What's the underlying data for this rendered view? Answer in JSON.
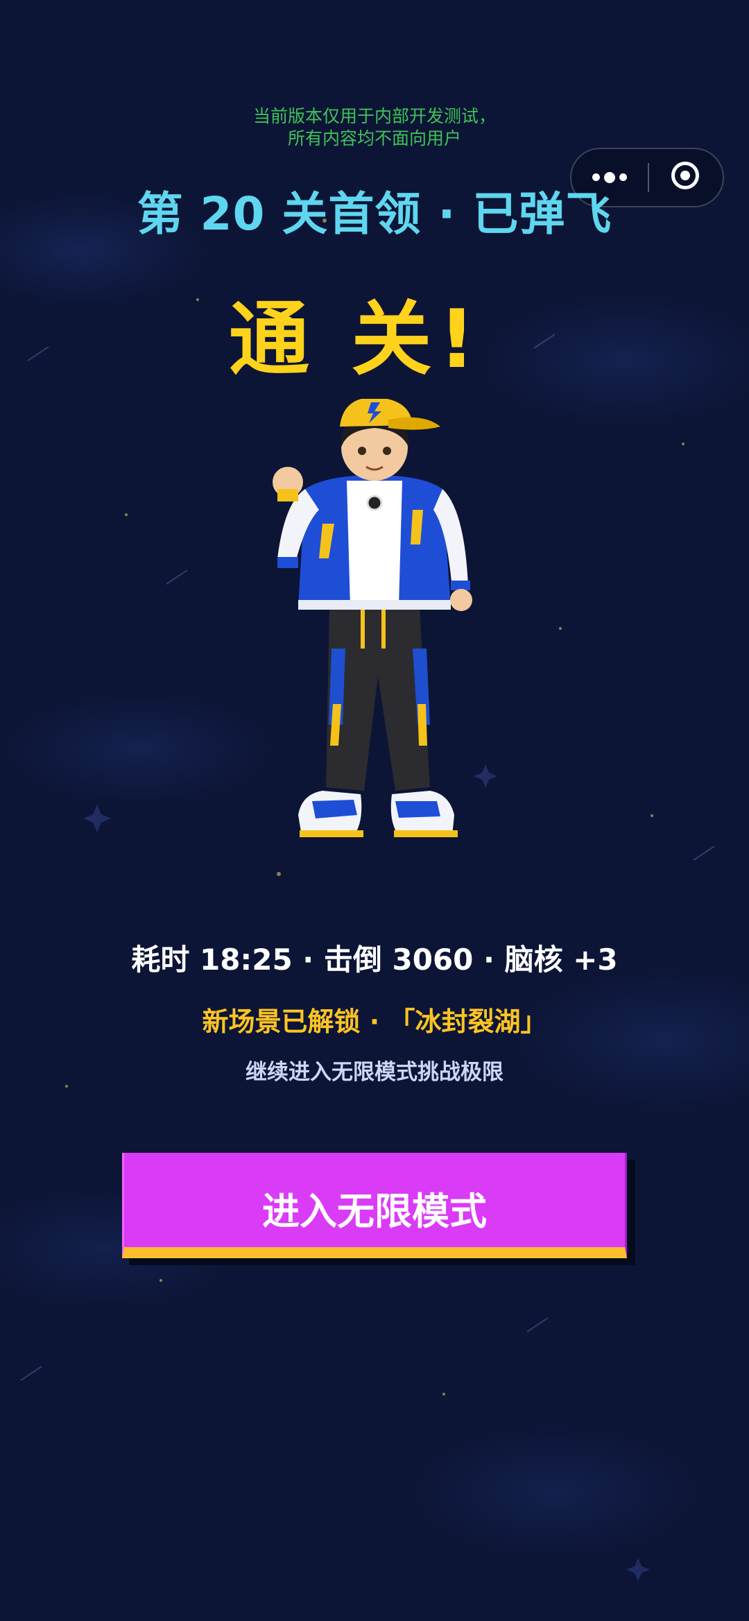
{
  "notice": {
    "line1": "当前版本仅用于内部开发测试，",
    "line2": "所有内容均不面向用户"
  },
  "capsule": {
    "more_icon": "more-dots-icon",
    "close_icon": "target-circle-icon"
  },
  "level_title": "第 20 关首领 · 已弹飞",
  "clear_title": "通 关!",
  "hero_image": "boy-character-illustration",
  "stats": "耗时 18:25 · 击倒 3060 · 脑核 +3",
  "unlock": "新场景已解锁 · 「冰封裂湖」",
  "hint": "继续进入无限模式挑战极限",
  "button": {
    "label": "进入无限模式"
  },
  "colors": {
    "background": "#0c1535",
    "notice": "#3fc35a",
    "level_title": "#5fd6ef",
    "clear_title": "#ffd21c",
    "unlock": "#ffc423",
    "button": "#da3bf7",
    "button_edge": "#ffbf2c"
  }
}
